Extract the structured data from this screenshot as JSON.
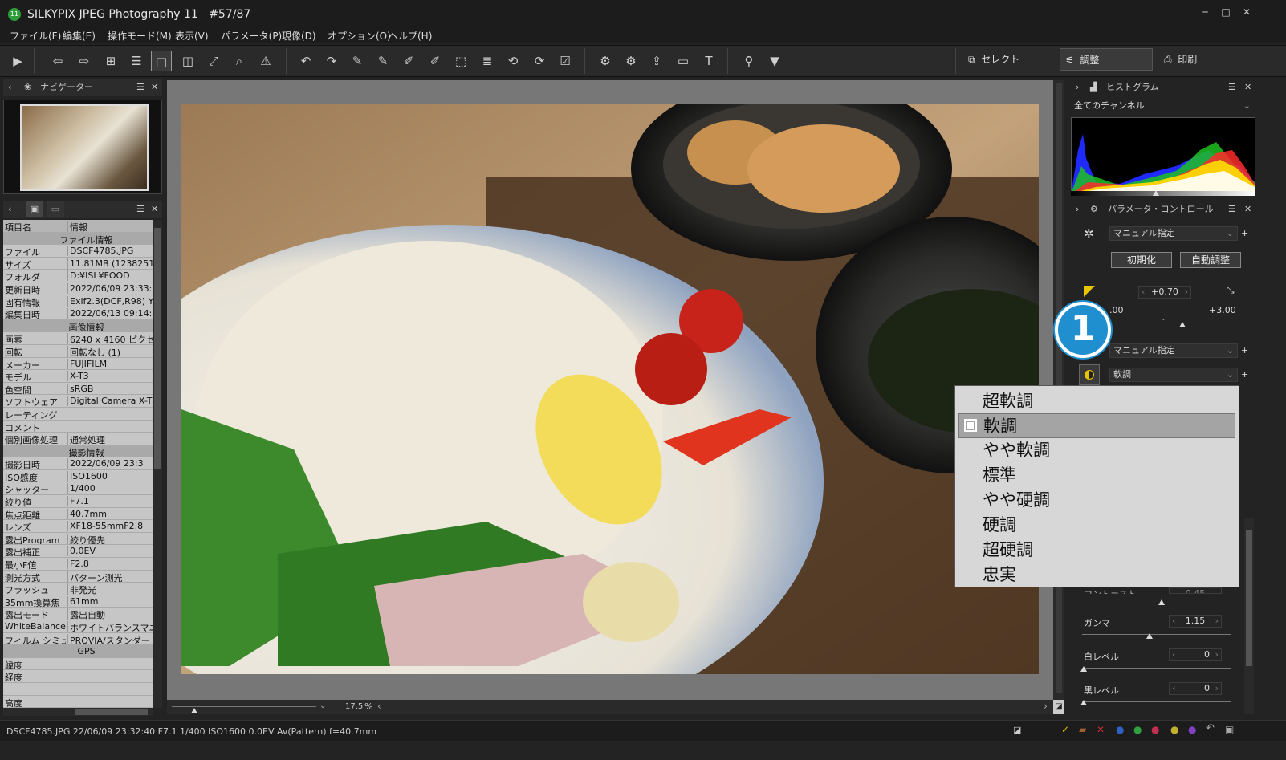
{
  "window": {
    "app_title": "SILKYPIX JPEG Photography 11",
    "counter": "#57/87"
  },
  "menu": [
    "ファイル(F)",
    "編集(E)",
    "操作モード(M)",
    "表示(V)",
    "パラメータ(P)",
    "現像(D)",
    "オプション(O)",
    "ヘルプ(H)"
  ],
  "toolbar": {
    "select_label": "セレクト",
    "adjust_label": "調整",
    "print_label": "印刷"
  },
  "navigator": {
    "title": "ナビゲーター"
  },
  "info": {
    "col_key": "項目名",
    "col_val": "情報",
    "sections": [
      {
        "title": "ファイル情報",
        "rows": [
          [
            "ファイル",
            "DSCF4785.JPG"
          ],
          [
            "サイズ",
            "11.81MB (1238251"
          ],
          [
            "フォルダ",
            "D:¥ISL¥FOOD"
          ],
          [
            "更新日時",
            "2022/06/09 23:33:"
          ],
          [
            "固有情報",
            "Exif2.3(DCF,R98) Y"
          ],
          [
            "編集日時",
            "2022/06/13 09:14:"
          ]
        ]
      },
      {
        "title": "画像情報",
        "rows": [
          [
            "画素",
            "6240 x 4160 ピクセ"
          ],
          [
            "回転",
            "回転なし (1)"
          ],
          [
            "メーカー",
            "FUJIFILM"
          ],
          [
            "モデル",
            "X-T3"
          ],
          [
            "色空間",
            "sRGB"
          ],
          [
            "ソフトウェア",
            "Digital Camera X-T"
          ],
          [
            "レーティング",
            ""
          ],
          [
            "コメント",
            ""
          ],
          [
            "個別画像処理",
            "通常処理"
          ]
        ]
      },
      {
        "title": "撮影情報",
        "rows": [
          [
            "撮影日時",
            "2022/06/09 23:3"
          ],
          [
            "ISO感度",
            "ISO1600"
          ],
          [
            "シャッター",
            "1/400"
          ],
          [
            "絞り値",
            "F7.1"
          ],
          [
            "焦点距離",
            "40.7mm"
          ],
          [
            "レンズ",
            "XF18-55mmF2.8"
          ],
          [
            "露出Program",
            "絞り優先"
          ],
          [
            "露出補正",
            "0.0EV"
          ],
          [
            "最小F値",
            "F2.8"
          ],
          [
            "測光方式",
            "パターン測光"
          ],
          [
            "フラッシュ",
            "非発光"
          ],
          [
            "35mm換算焦",
            "61mm"
          ],
          [
            "露出モード",
            "露出自動"
          ],
          [
            "WhiteBalance",
            "ホワイトバランスマニュア"
          ],
          [
            "フィルム シミュレ",
            "PROVIA/スタンダード"
          ]
        ]
      },
      {
        "title": "GPS",
        "rows": [
          [
            "緯度",
            ""
          ],
          [
            "経度",
            ""
          ],
          [
            "",
            ""
          ],
          [
            "高度",
            ""
          ],
          [
            "撮影方向",
            ""
          ]
        ]
      }
    ]
  },
  "viewer": {
    "zoom_value": "17.5",
    "zoom_unit": "%"
  },
  "histogram": {
    "title": "ヒストグラム",
    "channel": "全てのチャンネル"
  },
  "params": {
    "title": "パラメータ・コントロール",
    "preset": "マニュアル指定",
    "reset_label": "初期化",
    "auto_label": "自動調整",
    "exposure_value": "+0.70",
    "exposure_min": ".00",
    "exposure_max": "+3.00",
    "tone_preset": "マニュアル指定",
    "contrast_preset": "軟調",
    "contrast_label_partial": "コントラスト",
    "contrast_value": "0.45",
    "gamma_label": "ガンマ",
    "gamma_value": "1.15",
    "white_label": "白レベル",
    "white_value": "0",
    "black_label": "黒レベル",
    "black_value": "0"
  },
  "dropdown": {
    "items": [
      "超軟調",
      "軟調",
      "やや軟調",
      "標準",
      "やや硬調",
      "硬調",
      "超硬調",
      "忠実"
    ],
    "selected_index": 1
  },
  "callout": {
    "number": "1"
  },
  "status": {
    "text": "DSCF4785.JPG 22/06/09 23:32:40 F7.1 1/400 ISO1600  0.0EV Av(Pattern) f=40.7mm"
  }
}
